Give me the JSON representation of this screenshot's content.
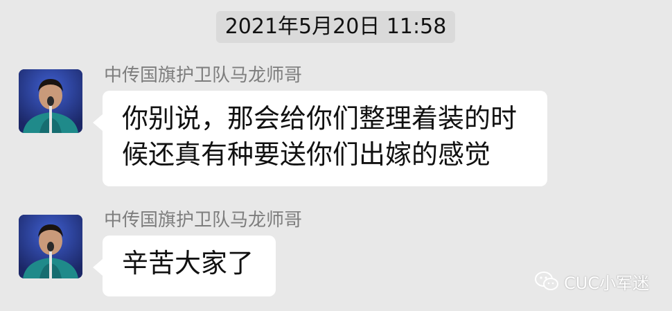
{
  "chat": {
    "timestamp": "2021年5月20日 11:58",
    "messages": [
      {
        "sender": "中传国旗护卫队马龙师哥",
        "lines": [
          "你别说，那会给你们整理着装的时",
          "候还真有种要送你们出嫁的感觉"
        ]
      },
      {
        "sender": "中传国旗护卫队马龙师哥",
        "lines": [
          "辛苦大家了"
        ]
      }
    ]
  },
  "watermark": {
    "text": "CUC小军迷",
    "icon": "wechat-icon"
  },
  "colors": {
    "background": "#e8e8e8",
    "timestamp_bg": "#dadada",
    "bubble": "#ffffff",
    "sender_text": "#7d7d7d"
  }
}
